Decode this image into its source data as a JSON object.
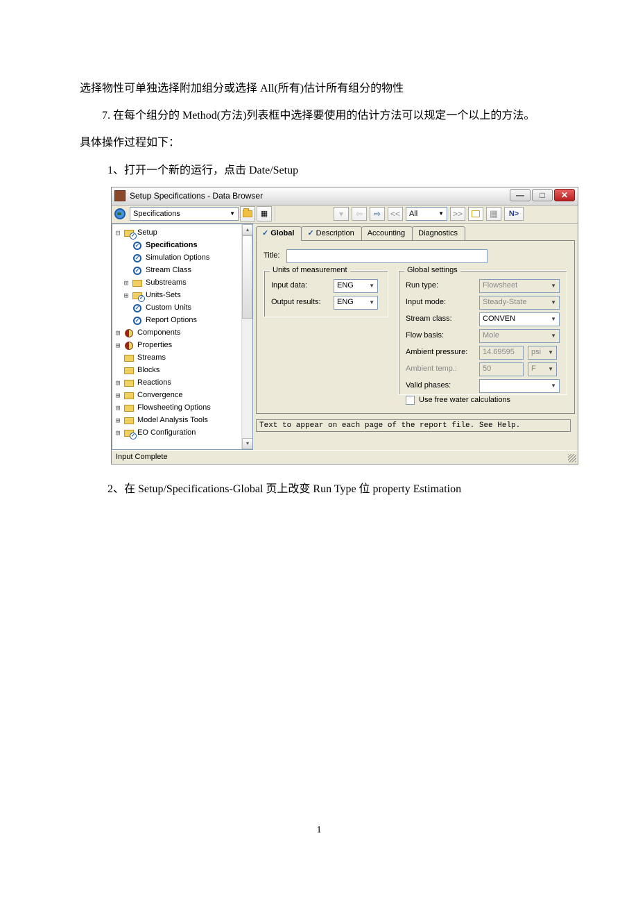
{
  "doc": {
    "p1": "选择物性可单独选择附加组分或选择 All(所有)估计所有组分的物性",
    "p2": "7.  在每个组分的 Method(方法)列表框中选择要使用的估计方法可以规定一个以上的方法。",
    "p3": "具体操作过程如下：",
    "p4": "1、打开一个新的运行，点击 Date/Setup",
    "p5": "2、在 Setup/Specifications-Global 页上改变 Run Type 位 property Estimation",
    "page_number": "1"
  },
  "app": {
    "title": "Setup Specifications - Data Browser",
    "toolbar": {
      "combo_label": "Specifications",
      "all_label": "All",
      "next_label": "N>"
    },
    "tree": {
      "setup": "Setup",
      "specifications": "Specifications",
      "simulation_options": "Simulation Options",
      "stream_class": "Stream Class",
      "substreams": "Substreams",
      "units_sets": "Units-Sets",
      "custom_units": "Custom Units",
      "report_options": "Report Options",
      "components": "Components",
      "properties": "Properties",
      "streams": "Streams",
      "blocks": "Blocks",
      "reactions": "Reactions",
      "convergence": "Convergence",
      "flowsheeting_options": "Flowsheeting Options",
      "model_analysis_tools": "Model Analysis Tools",
      "eo_configuration": "EO Configuration"
    },
    "tabs": {
      "global": "Global",
      "description": "Description",
      "accounting": "Accounting",
      "diagnostics": "Diagnostics"
    },
    "form": {
      "title_label": "Title:",
      "title_value": "",
      "units_group": "Units of measurement",
      "input_data_label": "Input data:",
      "input_data_value": "ENG",
      "output_results_label": "Output results:",
      "output_results_value": "ENG",
      "global_group": "Global settings",
      "run_type_label": "Run type:",
      "run_type_value": "Flowsheet",
      "input_mode_label": "Input mode:",
      "input_mode_value": "Steady-State",
      "stream_class_label": "Stream class:",
      "stream_class_value": "CONVEN",
      "flow_basis_label": "Flow basis:",
      "flow_basis_value": "Mole",
      "ambient_pressure_label": "Ambient pressure:",
      "ambient_pressure_value": "14.69595",
      "ambient_pressure_unit": "psi",
      "ambient_temp_label": "Ambient temp.:",
      "ambient_temp_value": "50",
      "ambient_temp_unit": "F",
      "valid_phases_label": "Valid phases:",
      "valid_phases_value": "",
      "free_water_label": "Use free water calculations"
    },
    "help_text": "Text to appear on each page of the report file. See Help.",
    "status": "Input Complete"
  }
}
